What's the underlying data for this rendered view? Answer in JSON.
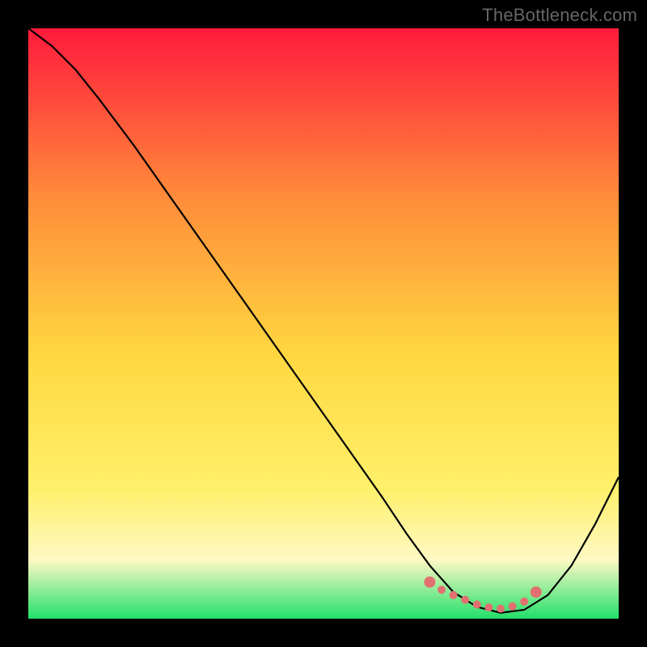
{
  "watermark": "TheBottleneck.com",
  "colors": {
    "bg_frame": "#000000",
    "grad_top": "#ff1a3c",
    "grad_mid_top": "#ff8a3a",
    "grad_mid": "#ffd740",
    "grad_low": "#fff06a",
    "grad_cream": "#fff9c4",
    "grad_bottom": "#22e06b",
    "curve": "#000000",
    "markers": "#e27070"
  },
  "chart_data": {
    "type": "line",
    "title": "",
    "xlabel": "",
    "ylabel": "",
    "xlim": [
      0,
      100
    ],
    "ylim": [
      0,
      100
    ],
    "grid": false,
    "series": [
      {
        "name": "bottleneck-curve",
        "x": [
          0,
          4,
          8,
          12,
          18,
          24,
          30,
          36,
          42,
          48,
          54,
          60,
          64,
          68,
          72,
          76,
          80,
          84,
          88,
          92,
          96,
          100
        ],
        "y": [
          100,
          97,
          93,
          88,
          80,
          71.5,
          63,
          54.5,
          46,
          37.5,
          29,
          20.5,
          14.5,
          9,
          4.5,
          2,
          1,
          1.5,
          4,
          9,
          16,
          24
        ]
      }
    ],
    "markers": {
      "name": "highlight-band",
      "x": [
        68,
        70,
        72,
        74,
        76,
        78,
        80,
        82,
        84,
        86
      ],
      "y": [
        6.2,
        4.9,
        4.0,
        3.2,
        2.4,
        1.9,
        1.7,
        2.1,
        2.9,
        4.5
      ]
    }
  }
}
